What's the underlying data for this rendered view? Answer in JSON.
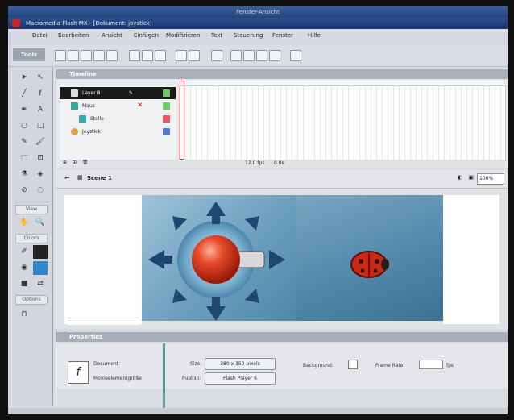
{
  "window": {
    "outer_title": "Fenster-Ansicht",
    "app_title": "Macromedia Flash MX - [Dokument: joystick]"
  },
  "menu": [
    "Datei",
    "Bearbeiten",
    "Ansicht",
    "Einfügen",
    "Modifizieren",
    "Text",
    "Steuerung",
    "Fenster",
    "Hilfe"
  ],
  "tools": {
    "label": "Tools",
    "view_label": "View",
    "colors_label": "Colors",
    "options_label": "Options"
  },
  "timeline": {
    "title": "Timeline",
    "layers": [
      {
        "name": "Layer 8",
        "selected": true
      },
      {
        "name": "Maus",
        "selected": false
      },
      {
        "name": "Stelle",
        "selected": false
      },
      {
        "name": "Joystick",
        "selected": false
      }
    ],
    "footer_fps": "12.0 fps",
    "footer_time": "0.0s"
  },
  "scene": {
    "name": "Scene 1",
    "zoom": "100%"
  },
  "properties": {
    "title": "Properties",
    "doc_label": "Document",
    "doc_name": "Movieelementgröße",
    "size_label": "Size:",
    "size_value": "380 x 350 pixels",
    "publish_label": "Publish:",
    "publish_value": "Flash Player 6",
    "background_label": "Background:",
    "frame_rate_label": "Frame Rate:",
    "frame_rate_unit": "fps"
  },
  "colors": {
    "title_blue": "#24457c",
    "stage_blue": "#6d9fbd",
    "arrow_navy": "#1f4670",
    "ball_red": "#d8391f"
  }
}
